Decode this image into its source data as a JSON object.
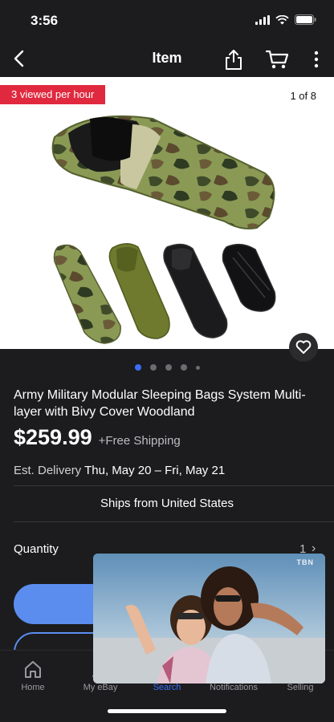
{
  "status_bar": {
    "time": "3:56"
  },
  "nav": {
    "title": "Item"
  },
  "gallery": {
    "badge": "3 viewed per hour",
    "counter": "1 of 8",
    "dots_total": 5,
    "active_dot": 1
  },
  "product": {
    "title": "Army Military Modular Sleeping Bags System Multi-layer with Bivy Cover Woodland",
    "price": "$259.99",
    "shipping": "+Free Shipping",
    "delivery_label": "Est. Delivery",
    "delivery_dates": "Thu, May 20 – Fri, May 21",
    "ships_from": "Ships from United States"
  },
  "quantity": {
    "label": "Quantity",
    "value": "1"
  },
  "tabs": [
    {
      "label": "Home",
      "icon": "home-icon"
    },
    {
      "label": "My eBay",
      "icon": "user-icon"
    },
    {
      "label": "Search",
      "icon": "search-icon"
    },
    {
      "label": "Notifications",
      "icon": "bell-icon"
    },
    {
      "label": "Selling",
      "icon": "tag-icon"
    }
  ],
  "video": {
    "watermark": "TBN"
  },
  "colors": {
    "accent": "#3b6ef5",
    "button": "#5b8def",
    "badge": "#e0293e",
    "background": "#1c1c1e"
  }
}
